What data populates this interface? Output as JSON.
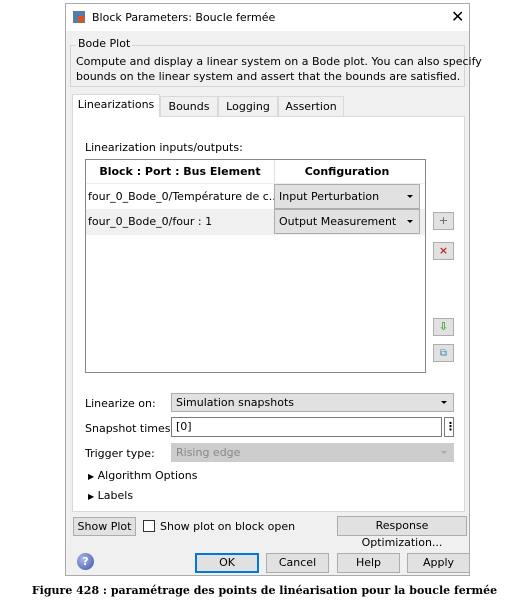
{
  "window": {
    "title": "Block Parameters: Boucle fermée",
    "close_icon": "close-icon"
  },
  "group": {
    "title": "Bode Plot",
    "description_line1": "Compute and display a linear system on a Bode plot. You can also specify",
    "description_line2": "bounds on the linear system and assert that the bounds are satisfied."
  },
  "tabs": [
    {
      "label": "Linearizations",
      "active": true
    },
    {
      "label": "Bounds"
    },
    {
      "label": "Logging"
    },
    {
      "label": "Assertion"
    }
  ],
  "io": {
    "label": "Linearization inputs/outputs:",
    "headers": [
      "Block : Port : Bus Element",
      "Configuration"
    ],
    "rows": [
      {
        "block": "four_0_Bode_0/Température de c...",
        "config": "Input Perturbation"
      },
      {
        "block": "four_0_Bode_0/four : 1",
        "config": "Output Measurement"
      }
    ],
    "side_buttons": {
      "add": "+",
      "remove": "×"
    }
  },
  "linearize_on": {
    "label": "Linearize on:",
    "value": "Simulation snapshots"
  },
  "snapshot": {
    "label": "Snapshot times:",
    "value": "[0]"
  },
  "trigger": {
    "label": "Trigger type:",
    "value": "Rising edge"
  },
  "sections": [
    "Algorithm Options",
    "Labels"
  ],
  "bottom": {
    "show_plot": "Show Plot",
    "show_on_open": "Show plot on block open",
    "response_opt": "Response Optimization...",
    "ok": "OK",
    "cancel": "Cancel",
    "help": "Help",
    "apply": "Apply"
  },
  "caption": "Figure 428 : paramétrage des points de linéarisation pour la boucle fermée"
}
